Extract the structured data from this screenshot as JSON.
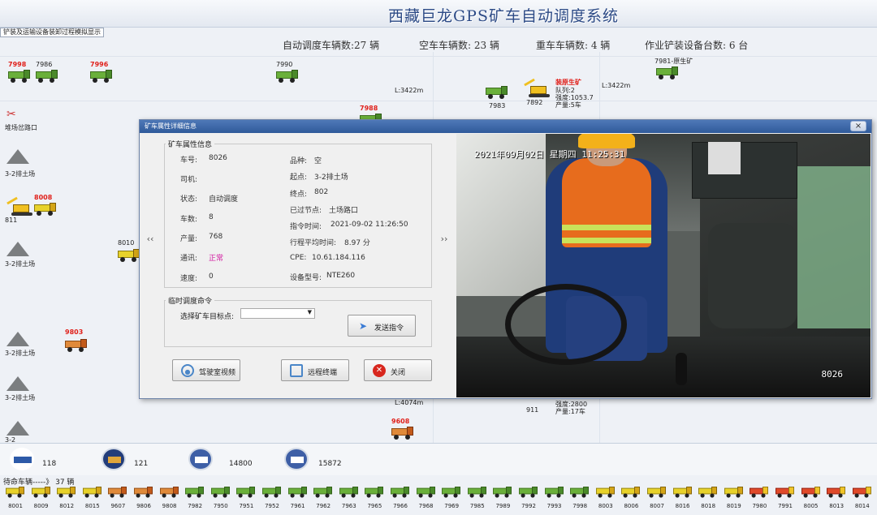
{
  "app": {
    "title": "西藏巨龙GPS矿车自动调度系统",
    "sim_label": "铲装及运输设备装卸过程模拟显示"
  },
  "stats": {
    "auto_label": "自动调度车辆数:27 辆",
    "empty_label": "空车车辆数: 23 辆",
    "heavy_label": "重车车辆数: 4 辆",
    "loader_label": "作业铲装设备台数: 6 台"
  },
  "map": {
    "labels": {
      "t7998": "7998",
      "t7986": "7986",
      "t7996": "7996",
      "t7990": "7990",
      "t7981": "7981-原生矿",
      "t7988": "7988",
      "t7983": "7983",
      "t7892": "7892",
      "t8008": "8008",
      "t8010": "8010",
      "t9803": "9803",
      "t9608": "9608",
      "t911": "911",
      "t811": "811",
      "dist1": "L:3422m",
      "dist2": "L:3422m",
      "dist3": "L:4074m",
      "junction": "堆场岔路口",
      "dump1": "3-2排土场",
      "dump2": "3-2排土场",
      "dump3": "3-2排土场",
      "dump4": "3-2排土场",
      "dump5": "3-2排土场",
      "dump6": "3-2",
      "mine_title": "装原生矿",
      "mine_queue": "队列:2",
      "mine_intensity": "强度:1053.7",
      "mine_output": "产量:5车",
      "south_intensity": "强度:2800",
      "south_output": "产量:17车"
    }
  },
  "dialog": {
    "title": "矿车属性详细信息",
    "close": "×",
    "prev": "‹‹",
    "next": "››",
    "attr_legend": "矿车属性信息",
    "left_fields": [
      {
        "key": "车号:",
        "value": "8026"
      },
      {
        "key": "司机:",
        "value": ""
      },
      {
        "key": "状态:",
        "value": "自动调度"
      },
      {
        "key": "车数:",
        "value": "8"
      },
      {
        "key": "产量:",
        "value": "768"
      },
      {
        "key": "通讯:",
        "value": "正常"
      },
      {
        "key": "速度:",
        "value": "0"
      }
    ],
    "right_fields": [
      {
        "key": "品种:",
        "value": "空"
      },
      {
        "key": "起点:",
        "value": "3-2排土场"
      },
      {
        "key": "终点:",
        "value": "802"
      },
      {
        "key": "已过节点:",
        "value": "土场路口"
      },
      {
        "key": "指令时间:",
        "value": "2021-09-02 11:26:50"
      },
      {
        "key": "行程平均时间:",
        "value": "8.97 分"
      },
      {
        "key": "CPE:",
        "value": "10.61.184.116"
      },
      {
        "key": "设备型号:",
        "value": "NTE260"
      }
    ],
    "cmd_legend": "临时调度命令",
    "target_label": "选择矿车目标点:",
    "target_value": "",
    "send_button": "发送指令",
    "cab_video_button": "驾驶室视频",
    "remote_button": "远程终端",
    "close_button": "关闭",
    "video_timestamp": "2021年09月02日  星期四  11:25:31",
    "video_truck_id": "8026"
  },
  "summary": {
    "v1": "118",
    "v2": "121",
    "v3": "14800",
    "v4": "15872"
  },
  "queue": {
    "label": "待命车辆-----》 37 辆",
    "items": [
      "8001",
      "8009",
      "8012",
      "8015",
      "9607",
      "9806",
      "9808",
      "7982",
      "7950",
      "7951",
      "7952",
      "7961",
      "7962",
      "7963",
      "7965",
      "7966",
      "7968",
      "7969",
      "7985",
      "7989",
      "7992",
      "7993",
      "7998",
      "8003",
      "8006",
      "8007",
      "8016",
      "8018",
      "8019",
      "7980",
      "7991",
      "8005",
      "8013",
      "8014"
    ]
  }
}
